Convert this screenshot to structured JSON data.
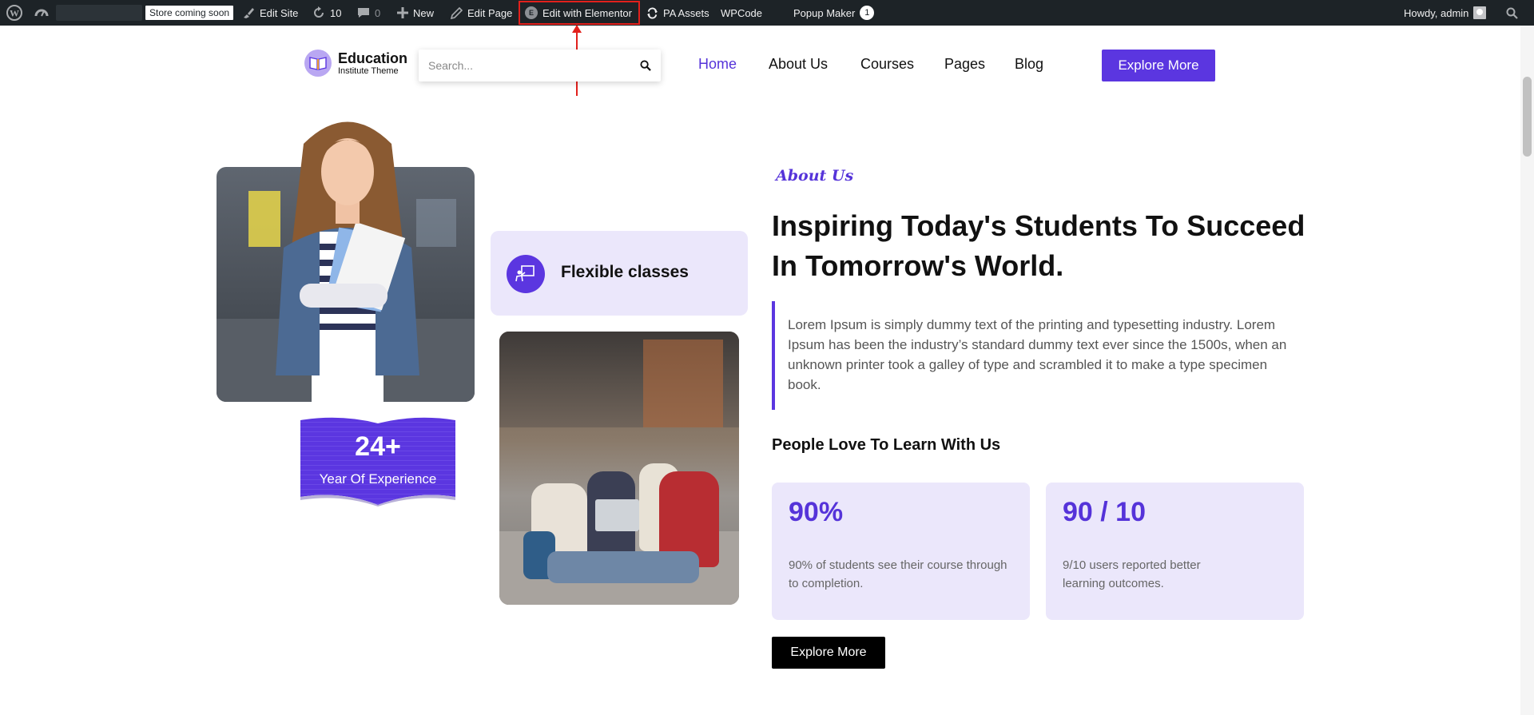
{
  "admin_bar": {
    "store_badge": "Store coming soon",
    "edit_site": "Edit Site",
    "updates_count": "10",
    "comments_count": "0",
    "new_label": "New",
    "edit_page": "Edit Page",
    "edit_elementor": "Edit with Elementor",
    "pa_assets": "PA Assets",
    "wpcode": "WPCode",
    "popup_maker": "Popup Maker",
    "popup_count": "1",
    "howdy": "Howdy, admin"
  },
  "header": {
    "logo_title": "Education",
    "logo_subtitle": "Institute Theme",
    "search_placeholder": "Search...",
    "nav": [
      "Home",
      "About Us",
      "Courses",
      "Pages",
      "Blog"
    ],
    "cta": "Explore More"
  },
  "hero": {
    "experience_value": "24+",
    "experience_label": "Year Of Experience",
    "flexible_label": "Flexible classes"
  },
  "about": {
    "kicker": "About Us",
    "headline": "Inspiring Today's Students To Succeed In Tomorrow's World.",
    "paragraph": "Lorem Ipsum is simply dummy text of the printing and typesetting industry. Lorem Ipsum has been the industry’s standard dummy text ever since the 1500s, when an unknown printer took a galley of type and scrambled it to make a type specimen book.",
    "subheading": "People Love To Learn With Us",
    "stats": [
      {
        "value": "90%",
        "description": "90% of students see their course through to completion."
      },
      {
        "value": "90 / 10",
        "description": "9/10 users reported better learning outcomes."
      }
    ],
    "cta": "Explore More"
  },
  "colors": {
    "accent": "#5b36e0",
    "card_bg": "#ebe7fb",
    "admin_bar": "#1d2327",
    "highlight": "#e2201c"
  }
}
